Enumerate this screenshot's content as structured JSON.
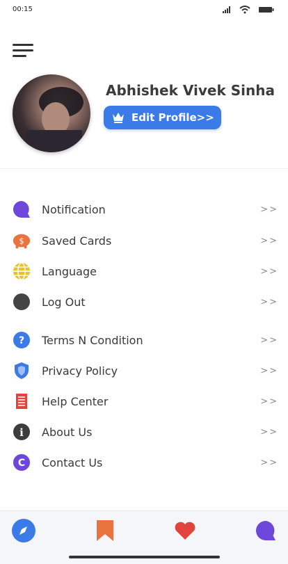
{
  "status_bar": {
    "time": "00:15"
  },
  "profile": {
    "name": "Abhishek Vivek Sinha",
    "edit_button_label": "Edit Profile>>"
  },
  "menu": {
    "arrow": ">>",
    "items": [
      {
        "label": "Notification",
        "icon": "chat-bubble-icon",
        "color": "#6c47d9"
      },
      {
        "label": "Saved Cards",
        "icon": "piggy-bank-icon",
        "color": "#e9743f"
      },
      {
        "label": "Language",
        "icon": "globe-icon",
        "color": "#e8c22a"
      },
      {
        "label": "Log Out",
        "icon": "logout-circle-icon",
        "color": "#444444"
      },
      {
        "label": "Terms N Condition",
        "icon": "question-icon",
        "color": "#3b7be8"
      },
      {
        "label": "Privacy Policy",
        "icon": "shield-icon",
        "color": "#3b7be8"
      },
      {
        "label": "Help Center",
        "icon": "document-icon",
        "color": "#e0443b"
      },
      {
        "label": "About Us",
        "icon": "info-icon",
        "color": "#3d3d3d"
      },
      {
        "label": "Contact Us",
        "icon": "c-circle-icon",
        "color": "#6c47d9"
      }
    ]
  },
  "bottom_nav": {
    "items": [
      {
        "icon": "compass-icon",
        "color": "#3b7be8"
      },
      {
        "icon": "bookmark-icon",
        "color": "#e9743f"
      },
      {
        "icon": "heart-icon",
        "color": "#e0443b"
      },
      {
        "icon": "chat-bubble-icon",
        "color": "#6c47d9"
      }
    ]
  },
  "colors": {
    "accent": "#3b7be8"
  }
}
